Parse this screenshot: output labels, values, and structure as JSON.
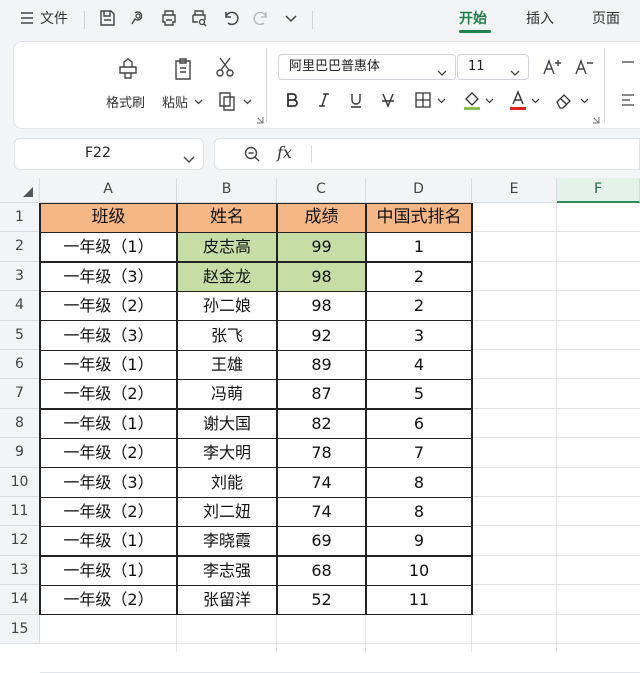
{
  "menu": {
    "file_label": "文件",
    "tabs": [
      {
        "label": "开始",
        "active": true
      },
      {
        "label": "插入",
        "active": false
      },
      {
        "label": "页面",
        "active": false
      }
    ]
  },
  "ribbon": {
    "format_painter_label": "格式刷",
    "paste_label": "粘贴",
    "font_name": "阿里巴巴普惠体",
    "font_size": "11"
  },
  "formula_bar": {
    "name_box": "F22",
    "fx_label": "fx",
    "content": ""
  },
  "sheet": {
    "columns": [
      "A",
      "B",
      "C",
      "D",
      "E",
      "F"
    ],
    "selected_column": "F",
    "rows": [
      "1",
      "2",
      "3",
      "4",
      "5",
      "6",
      "7",
      "8",
      "9",
      "10",
      "11",
      "12",
      "13",
      "14",
      "15"
    ],
    "headers": [
      "班级",
      "姓名",
      "成绩",
      "中国式排名"
    ],
    "data": [
      [
        "一年级（1）",
        "皮志高",
        "99",
        "1"
      ],
      [
        "一年级（3）",
        "赵金龙",
        "98",
        "2"
      ],
      [
        "一年级（2）",
        "孙二娘",
        "98",
        "2"
      ],
      [
        "一年级（3）",
        "张飞",
        "92",
        "3"
      ],
      [
        "一年级（1）",
        "王雄",
        "89",
        "4"
      ],
      [
        "一年级（2）",
        "冯萌",
        "87",
        "5"
      ],
      [
        "一年级（1）",
        "谢大国",
        "82",
        "6"
      ],
      [
        "一年级（2）",
        "李大明",
        "78",
        "7"
      ],
      [
        "一年级（3）",
        "刘能",
        "74",
        "8"
      ],
      [
        "一年级（2）",
        "刘二妞",
        "74",
        "8"
      ],
      [
        "一年级（1）",
        "李晓霞",
        "69",
        "9"
      ],
      [
        "一年级（1）",
        "李志强",
        "68",
        "10"
      ],
      [
        "一年级（2）",
        "张留洋",
        "52",
        "11"
      ]
    ],
    "highlighted_rows": [
      2,
      3
    ],
    "colors": {
      "header_fill": "#f6b787",
      "highlight_fill": "#c6dea6",
      "accent": "#1e7f4a"
    }
  }
}
